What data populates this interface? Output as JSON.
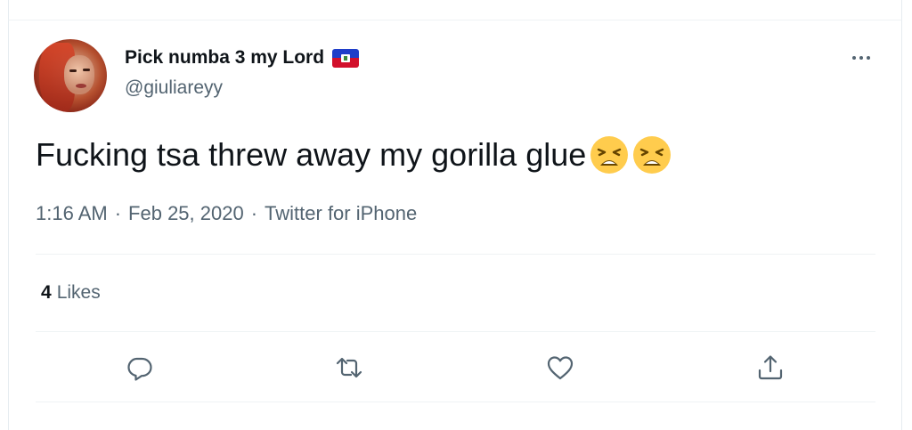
{
  "tweet": {
    "display_name": "Pick numba 3 my Lord",
    "handle": "@giuliareyy",
    "text": "Fucking tsa threw away my gorilla glue",
    "emojis": [
      "weary-face",
      "weary-face"
    ],
    "time": "1:16 AM",
    "date": "Feb 25, 2020",
    "source": "Twitter for iPhone",
    "separator": "·",
    "likes_count": "4",
    "likes_label": "Likes"
  },
  "icons": {
    "flag": "haiti-flag-icon",
    "more": "more-options-icon",
    "reply": "reply-icon",
    "retweet": "retweet-icon",
    "like": "heart-icon",
    "share": "share-icon"
  },
  "colors": {
    "text_primary": "#0f1419",
    "text_secondary": "#536471",
    "divider": "#eff3f4",
    "flag_blue": "#1f3ec9",
    "flag_red": "#d2102b",
    "emoji_yellow": "#ffcc4d"
  }
}
